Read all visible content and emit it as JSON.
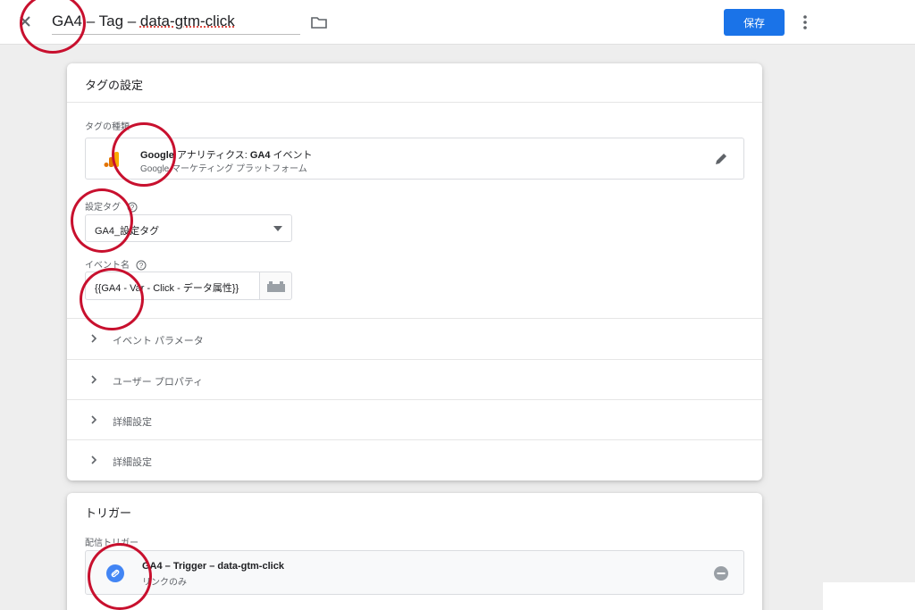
{
  "header": {
    "title_prefix": "GA4 – Tag – ",
    "title_underlined": "data-gtm-click",
    "save_label": "保存"
  },
  "tag_card": {
    "heading": "タグの設定",
    "tag_type_label": "タグの種類",
    "tag_type_brand": "Google",
    "tag_type_name_rest": " アナリティクス: ",
    "tag_type_name_bold": "GA4",
    "tag_type_name_end": " イベント",
    "tag_type_sub": "Google マーケティング プラットフォーム",
    "config_tag_label": "設定タグ",
    "config_tag_value": "GA4_設定タグ",
    "event_name_label": "イベント名",
    "event_name_value": "{{GA4 - Var - Click - データ属性}}",
    "sections": [
      "イベント パラメータ",
      "ユーザー プロパティ",
      "詳細設定",
      "詳細設定"
    ]
  },
  "trigger_card": {
    "heading": "トリガー",
    "firing_label": "配信トリガー",
    "trigger_name": "GA4 – Trigger – data-gtm-click",
    "trigger_sub": "リンクのみ"
  },
  "colors": {
    "accent": "#1a73e8",
    "annotation": "#c8102e",
    "analytics_orange": "#f9ab00",
    "analytics_dark": "#e37400",
    "link_blue": "#4285f4"
  },
  "icons": [
    "close-icon",
    "folder-icon",
    "more-vert-icon",
    "analytics-logo-icon",
    "edit-icon",
    "help-icon",
    "dropdown-arrow-icon",
    "variable-icon",
    "chevron-right-icon",
    "link-icon",
    "remove-icon"
  ]
}
